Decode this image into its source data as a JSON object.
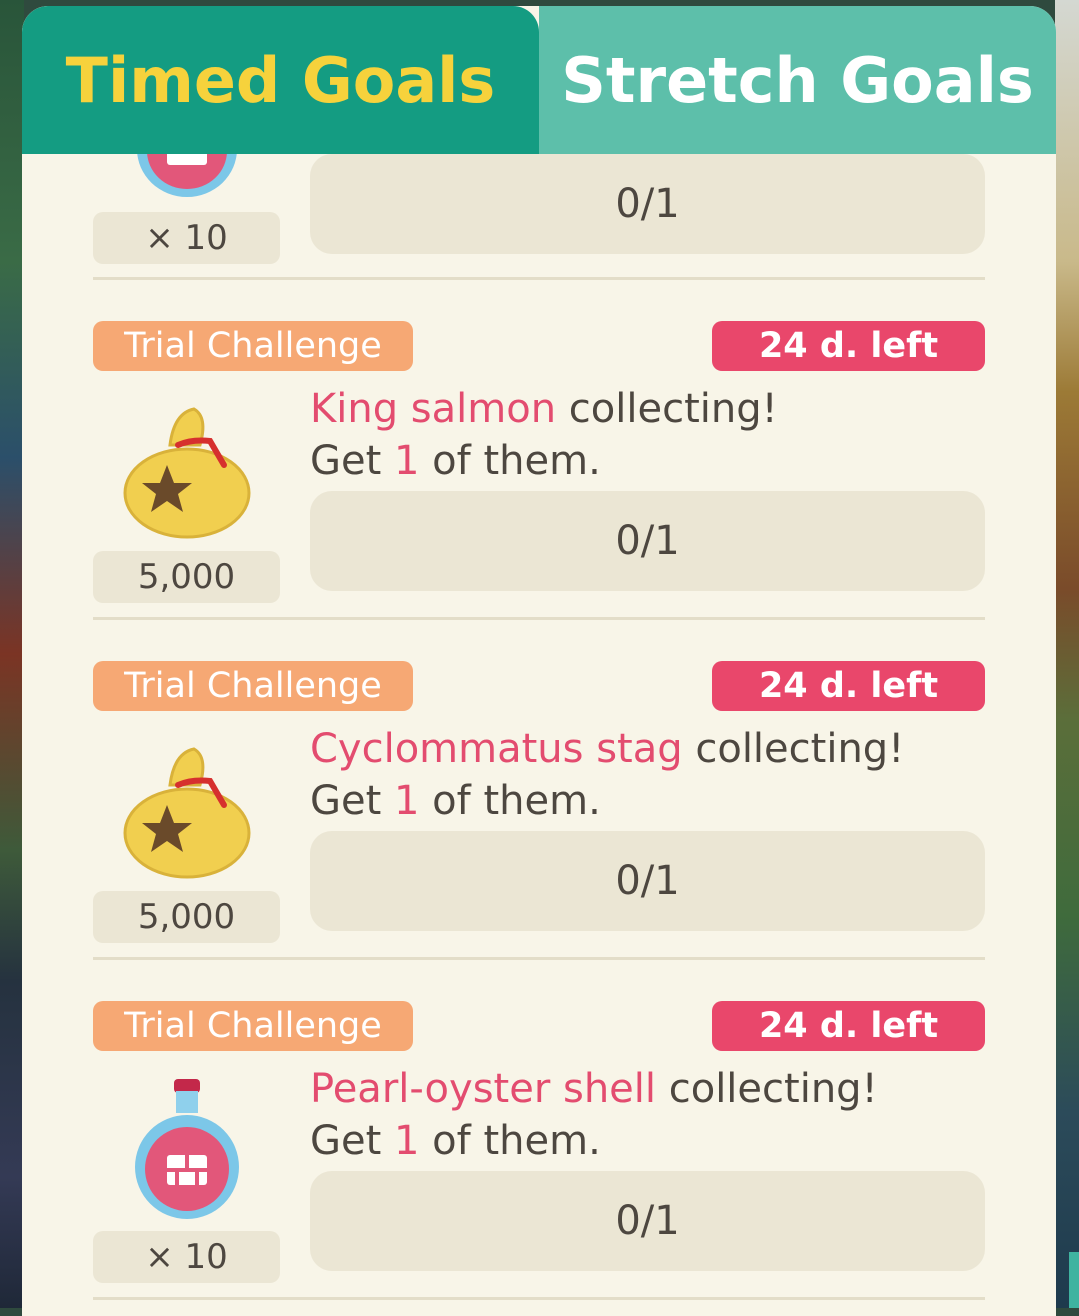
{
  "tabs": {
    "timed": "Timed Goals",
    "stretch": "Stretch Goals"
  },
  "top_goal": {
    "reward_qty": "× 10",
    "reward_icon": "potion-icon",
    "progress": "0/1"
  },
  "goals": [
    {
      "badge": "Trial Challenge",
      "days_left": "24 d. left",
      "target": "King salmon",
      "suffix": " collecting!",
      "line2_prefix": "Get ",
      "count": "1",
      "line2_suffix": " of them.",
      "reward_icon": "bell-bag-icon",
      "reward_qty": "5,000",
      "progress": "0/1"
    },
    {
      "badge": "Trial Challenge",
      "days_left": "24 d. left",
      "target": "Cyclommatus stag",
      "suffix": " collecting!",
      "line2_prefix": "Get ",
      "count": "1",
      "line2_suffix": " of them.",
      "reward_icon": "bell-bag-icon",
      "reward_qty": "5,000",
      "progress": "0/1"
    },
    {
      "badge": "Trial Challenge",
      "days_left": "24 d. left",
      "target": "Pearl-oyster shell",
      "suffix": " collecting!",
      "line2_prefix": "Get ",
      "count": "1",
      "line2_suffix": " of them.",
      "reward_icon": "potion-icon",
      "reward_qty": "× 10",
      "progress": "0/1"
    }
  ],
  "colors": {
    "tab_active_bg": "#149c82",
    "tab_active_text": "#f6d23c",
    "tab_inactive_bg": "#5dbfaa",
    "badge_trial": "#f6a874",
    "badge_days": "#e9476b",
    "highlight": "#e34c6f",
    "panel_bg": "#f8f5e8"
  }
}
